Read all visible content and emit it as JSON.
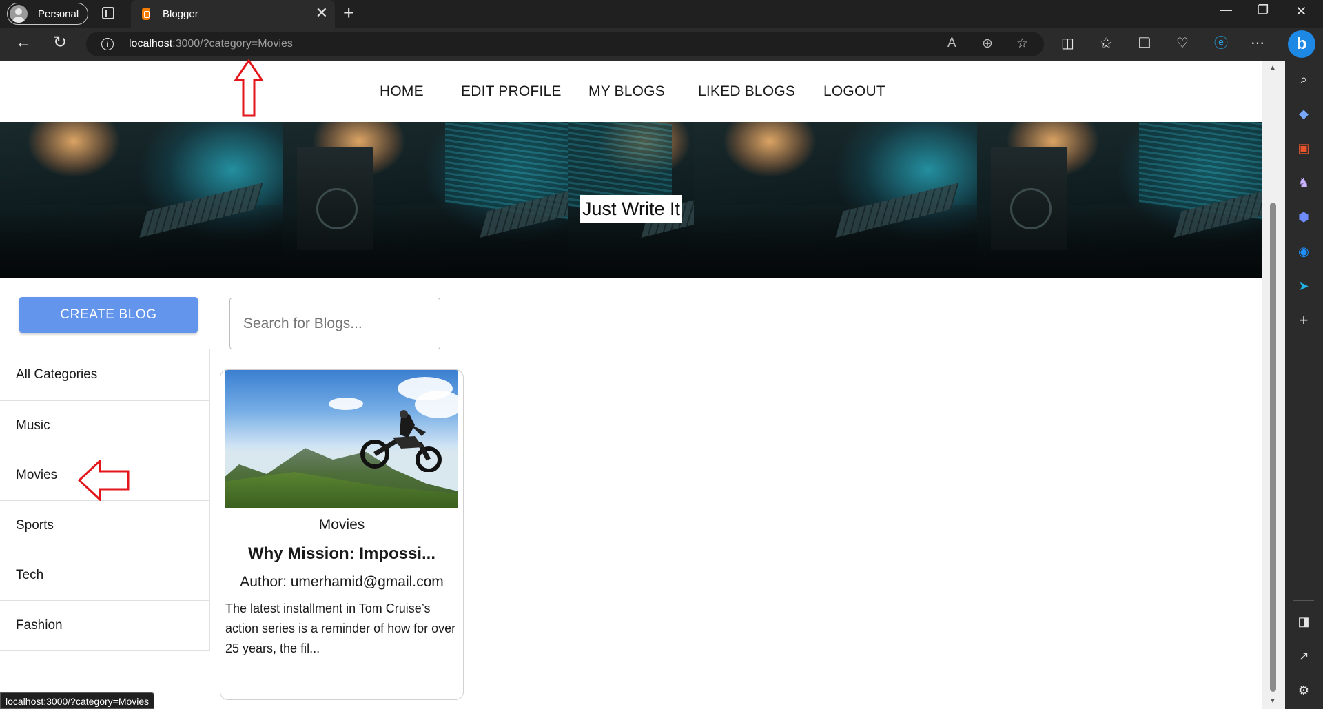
{
  "browser": {
    "profile_label": "Personal",
    "tab_title": "Blogger",
    "url_host": "localhost",
    "url_rest": ":3000/?category=Movies",
    "status_url": "localhost:3000/?category=Movies"
  },
  "site_nav": {
    "items": [
      {
        "label": "HOME"
      },
      {
        "label": "EDIT PROFILE"
      },
      {
        "label": "MY BLOGS"
      },
      {
        "label": "LIKED BLOGS"
      },
      {
        "label": "LOGOUT"
      }
    ]
  },
  "hero": {
    "title": "Just Write It"
  },
  "sidebar": {
    "create_label": "CREATE BLOG",
    "categories": [
      {
        "label": "All Categories"
      },
      {
        "label": "Music"
      },
      {
        "label": "Movies"
      },
      {
        "label": "Sports"
      },
      {
        "label": "Tech"
      },
      {
        "label": "Fashion"
      }
    ]
  },
  "search": {
    "placeholder": "Search for Blogs...",
    "value": ""
  },
  "posts": [
    {
      "category": "Movies",
      "title": "Why Mission: Impossi...",
      "author": "Author: umerhamid@gmail.com",
      "description": "The latest installment in Tom Cruise’s action series is a reminder of how for over 25 years, the fil..."
    }
  ],
  "colors": {
    "accent_button": "#6495ed",
    "annotation_red": "#e3161c",
    "browser_dark": "#202020"
  }
}
